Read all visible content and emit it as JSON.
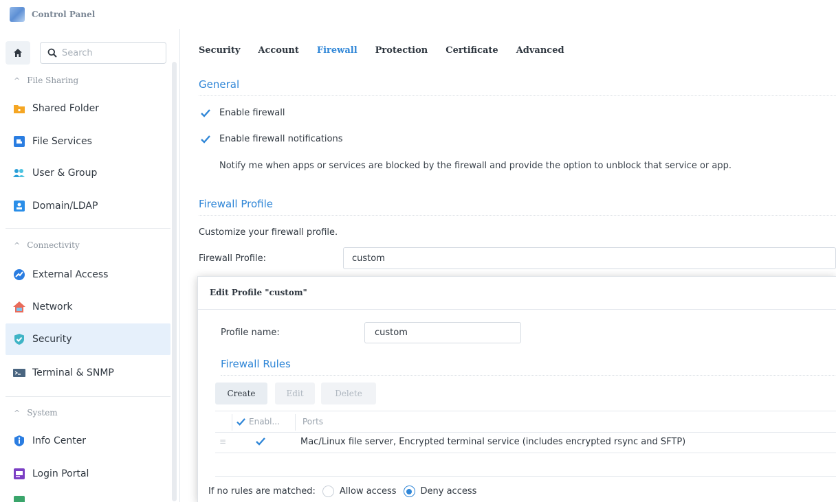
{
  "window": {
    "title": "Control Panel"
  },
  "sidebar": {
    "search_placeholder": "Search",
    "groups": [
      {
        "label": "File Sharing",
        "items": [
          "Shared Folder",
          "File Services",
          "User & Group",
          "Domain/LDAP"
        ]
      },
      {
        "label": "Connectivity",
        "items": [
          "External Access",
          "Network",
          "Security",
          "Terminal & SNMP"
        ]
      },
      {
        "label": "System",
        "items": [
          "Info Center",
          "Login Portal"
        ]
      }
    ],
    "active_item": "Security"
  },
  "tabs": [
    "Security",
    "Account",
    "Firewall",
    "Protection",
    "Certificate",
    "Advanced"
  ],
  "active_tab": "Firewall",
  "general": {
    "title": "General",
    "enable_firewall": {
      "label": "Enable firewall",
      "checked": true
    },
    "enable_notifications": {
      "label": "Enable firewall notifications",
      "checked": true
    },
    "note": "Notify me when apps or services are blocked by the firewall and provide the option to unblock that service or app."
  },
  "profile": {
    "title": "Firewall Profile",
    "description": "Customize your firewall profile.",
    "label": "Firewall Profile:",
    "value": "custom"
  },
  "dialog": {
    "title": "Edit Profile \"custom\"",
    "profile_name_label": "Profile name:",
    "profile_name_value": "custom",
    "rules_title": "Firewall Rules",
    "buttons": {
      "create": "Create",
      "edit": "Edit",
      "delete": "Delete"
    },
    "columns": {
      "enabled": "Enabl...",
      "ports": "Ports"
    },
    "rows": [
      {
        "enabled": true,
        "ports": "Mac/Linux file server, Encrypted terminal service (includes encrypted rsync and SFTP)"
      }
    ],
    "no_match_label": "If no rules are matched:",
    "allow_label": "Allow access",
    "deny_label": "Deny access",
    "selected": "deny"
  },
  "colors": {
    "accent": "#2f86d7",
    "active_bg": "#e6f0fb"
  }
}
